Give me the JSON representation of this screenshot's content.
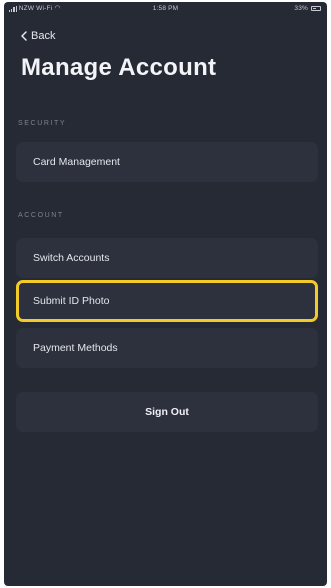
{
  "status_bar": {
    "carrier": "NZW Wi-Fi",
    "time": "1:58 PM",
    "battery": "33%"
  },
  "nav": {
    "back_label": "Back"
  },
  "page": {
    "title": "Manage Account"
  },
  "sections": {
    "security": {
      "header": "SECURITY",
      "items": [
        "Card Management"
      ]
    },
    "account": {
      "header": "ACCOUNT",
      "items": [
        "Switch Accounts",
        "Submit ID Photo",
        "Payment Methods"
      ]
    }
  },
  "actions": {
    "sign_out_label": "Sign Out"
  },
  "colors": {
    "background": "#262a35",
    "row_background": "#2c313d",
    "highlight_border": "#f2cb2a"
  }
}
